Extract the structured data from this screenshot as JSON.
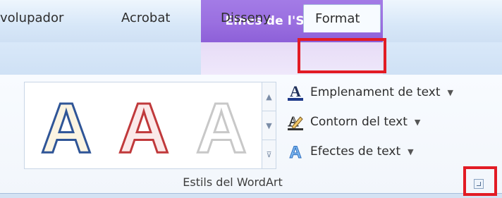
{
  "contextual_header": {
    "title": "Eines de l'SmartArt",
    "color": "#9a6fe0"
  },
  "tabs": [
    {
      "label": "volupador"
    },
    {
      "label": "Acrobat"
    },
    {
      "label": "Disseny"
    },
    {
      "label": "Format",
      "selected": true
    }
  ],
  "wordart_gallery": {
    "items": [
      {
        "letter": "A",
        "style": "blue-outline",
        "stroke": "#2f5597",
        "fill": "#fbf4e2"
      },
      {
        "letter": "A",
        "style": "red-outline",
        "stroke": "#c0393b",
        "fill": "#fbe9e9"
      },
      {
        "letter": "A",
        "style": "white-outline",
        "stroke": "#c8c8c8",
        "fill": "#ffffff"
      }
    ]
  },
  "commands": {
    "text_fill": "Emplenament de text",
    "text_outline": "Contorn del text",
    "text_effects": "Efectes de text"
  },
  "group": {
    "label": "Estils del WordArt"
  },
  "highlight_color": "#e21b24"
}
